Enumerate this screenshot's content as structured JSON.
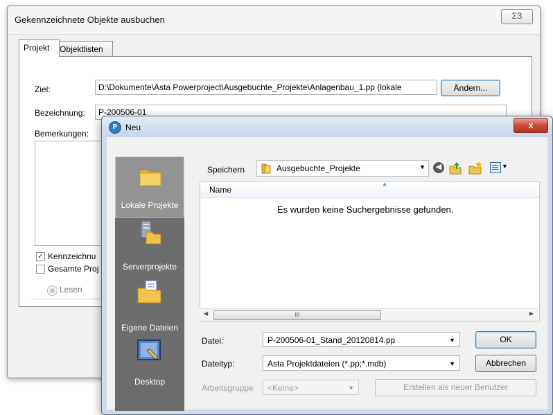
{
  "back_dialog": {
    "title": "Gekennzeichnete Objekte ausbuchen",
    "close_glyph": "ΣЗ",
    "tabs": [
      "Projekt",
      "Objektlisten"
    ],
    "ziel_label": "Ziel:",
    "ziel_value": "D:\\Dokumente\\Asta Powerproject\\Ausgebuchte_Projekte\\Anlagenbau_1.pp (lokale",
    "change_button": "Ändern...",
    "bezeichnung_label": "Bezeichnung:",
    "bezeichnung_value": "P-200506-01",
    "bemerkungen_label": "Bemerkungen:",
    "check1_label": "Kennzeichnu",
    "check1_checked": true,
    "check2_label": "Gesamte Proj",
    "check2_checked": false,
    "radio_label": "Lesen"
  },
  "front_dialog": {
    "title": "Neu",
    "app_icon": "P",
    "close_glyph": "x",
    "places": [
      {
        "label": "Lokale Projekte",
        "icon": "folder-icon",
        "selected": true
      },
      {
        "label": "Serverprojekte",
        "icon": "server-icon",
        "selected": false
      },
      {
        "label": "Eigene Dateien",
        "icon": "documents-folder-icon",
        "selected": false
      },
      {
        "label": "Desktop",
        "icon": "desktop-icon",
        "selected": false
      }
    ],
    "save_in_label": "Speichern",
    "save_in_value": "Ausgebuchte_Projekte",
    "column_name": "Name",
    "empty_message": "Es wurden keine Suchergebnisse gefunden.",
    "scroll_grip": "III",
    "file_label": "Datei:",
    "file_value": "P-200506-01_Stand_20120814.pp",
    "filetype_label": "Dateityp:",
    "filetype_value": "Asta Projektdateien (*.pp;*.mdb)",
    "workgroup_label": "Arbeitsgruppe",
    "workgroup_value": "<Keine>",
    "ok_button": "OK",
    "cancel_button": "Abbrechen",
    "create_user_button": "Erstellen als neuer Benutzer"
  },
  "colors": {
    "places_bg": "#6d6d6d",
    "places_selected": "#939393",
    "close_red": "#c94a37",
    "checkbox_blue": "#22409d"
  }
}
